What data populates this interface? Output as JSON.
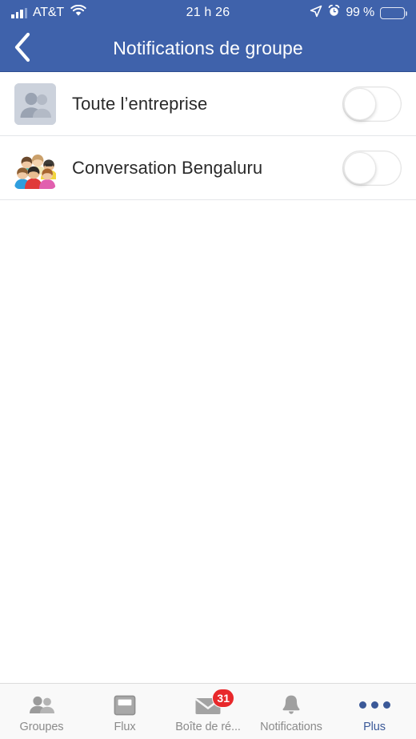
{
  "status_bar": {
    "carrier": "AT&T",
    "time": "21 h 26",
    "battery_percent": "99 %",
    "signal_icon": "signal-bars-icon",
    "wifi_icon": "wifi-icon",
    "location_icon": "location-arrow-icon",
    "alarm_icon": "alarm-clock-icon",
    "battery_icon": "battery-full-icon"
  },
  "nav": {
    "title": "Notifications de groupe",
    "back_icon": "back-chevron-icon",
    "background_color": "#3f62ab"
  },
  "list": {
    "rows": [
      {
        "label": "Toute l’entreprise",
        "avatar_icon": "group-placeholder-avatar",
        "toggle_state": "off"
      },
      {
        "label": "Conversation Bengaluru",
        "avatar_icon": "people-group-photo-avatar",
        "toggle_state": "off"
      }
    ]
  },
  "tab_bar": {
    "active_color": "#3b5998",
    "inactive_color": "#8b8b8b",
    "badge_color": "#e8282b",
    "tabs": [
      {
        "label": "Groupes",
        "icon": "people-icon",
        "active": false,
        "badge": ""
      },
      {
        "label": "Flux",
        "icon": "feed-icon",
        "active": false,
        "badge": ""
      },
      {
        "label": "Boîte de ré...",
        "icon": "envelope-icon",
        "active": false,
        "badge": "31"
      },
      {
        "label": "Notifications",
        "icon": "bell-icon",
        "active": false,
        "badge": ""
      },
      {
        "label": "Plus",
        "icon": "more-dots-icon",
        "active": true,
        "badge": ""
      }
    ]
  }
}
